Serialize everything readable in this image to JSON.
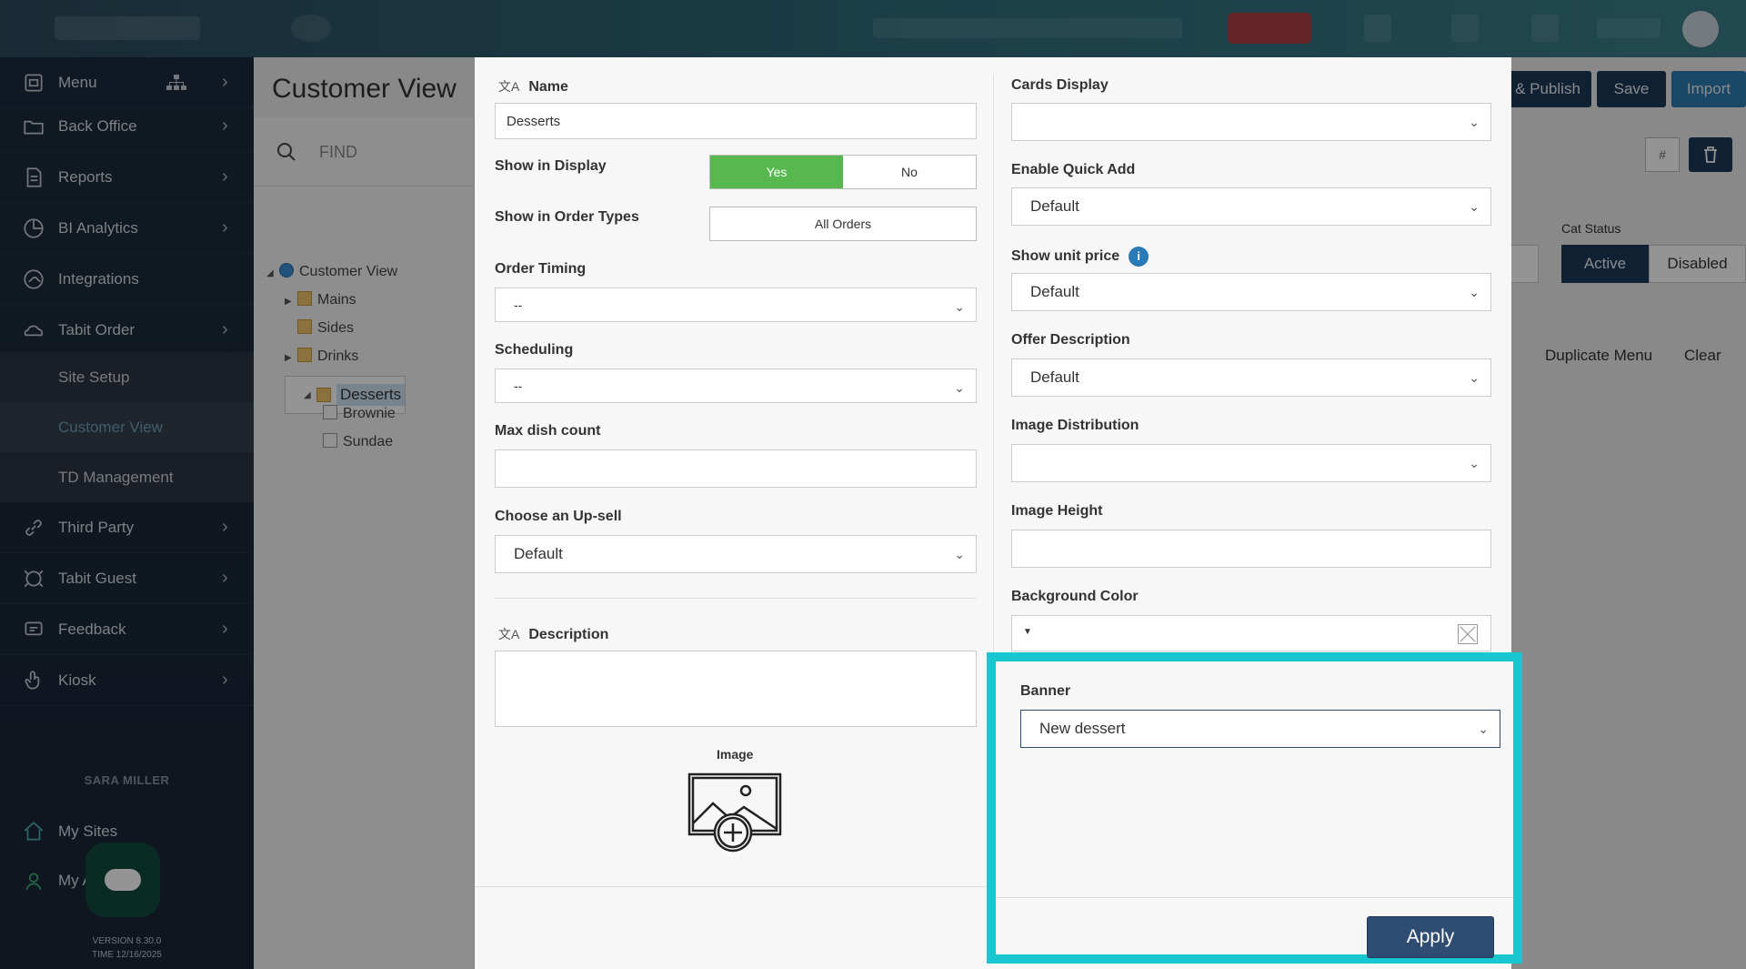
{
  "sidebar": {
    "items": [
      {
        "label": "Menu"
      },
      {
        "label": "Back Office"
      },
      {
        "label": "Reports"
      },
      {
        "label": "BI Analytics"
      },
      {
        "label": "Integrations"
      },
      {
        "label": "Tabit Order"
      }
    ],
    "subitems": [
      {
        "label": "Site Setup"
      },
      {
        "label": "Customer View"
      },
      {
        "label": "TD Management"
      }
    ],
    "items2": [
      {
        "label": "Third Party"
      },
      {
        "label": "Tabit Guest"
      },
      {
        "label": "Feedback"
      },
      {
        "label": "Kiosk"
      }
    ],
    "user_name": "SARA MILLER",
    "bottom_items": [
      {
        "label": "My Sites"
      },
      {
        "label": "My Account"
      }
    ],
    "version": "VERSION 8.30.0",
    "time": "TIME 12/16/2025"
  },
  "page": {
    "title": "Customer View",
    "find_placeholder": "FIND",
    "tree": {
      "root": "Customer View",
      "nodes": [
        "Mains",
        "Sides",
        "Drinks",
        "Desserts",
        "Brownie",
        "Sundae"
      ]
    },
    "toolbar": {
      "publish": "& Publish",
      "save": "Save",
      "import": "Import",
      "hash": "#"
    },
    "cat_status": {
      "label": "Cat Status",
      "active": "Active",
      "disabled": "Disabled"
    },
    "duplicate_menu": "Duplicate Menu",
    "clear": "Clear"
  },
  "modal": {
    "name_label": "Name",
    "name_value": "Desserts",
    "show_in_display_label": "Show in Display",
    "show_yes": "Yes",
    "show_no": "No",
    "order_types_label": "Show in Order Types",
    "order_types_value": "All Orders",
    "order_timing_label": "Order Timing",
    "order_timing_value": "--",
    "scheduling_label": "Scheduling",
    "scheduling_value": "--",
    "max_dish_label": "Max dish count",
    "upsell_label": "Choose an Up-sell",
    "upsell_value": "Default",
    "description_label": "Description",
    "image_label": "Image",
    "cards_display_label": "Cards Display",
    "quick_add_label": "Enable Quick Add",
    "quick_add_value": "Default",
    "unit_price_label": "Show unit price",
    "unit_price_value": "Default",
    "offer_desc_label": "Offer Description",
    "offer_desc_value": "Default",
    "image_dist_label": "Image Distribution",
    "image_height_label": "Image Height",
    "bg_color_label": "Background Color",
    "banner_label": "Banner",
    "banner_value": "New dessert",
    "apply": "Apply"
  },
  "colors": {
    "highlight": "#17c6cf",
    "yes_green": "#57b84f",
    "apply_blue": "#2f4d73"
  }
}
